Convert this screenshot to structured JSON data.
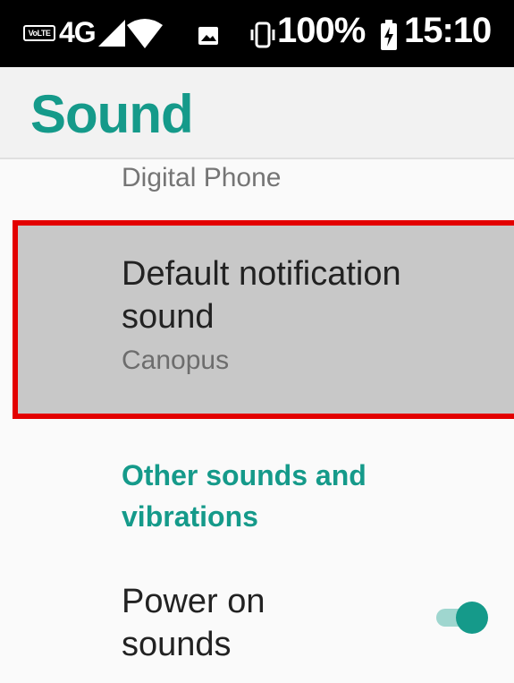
{
  "status_bar": {
    "volte": "VoLTE",
    "network": "4G",
    "battery": "100%",
    "time": "15:10",
    "icons": [
      "signal-icon",
      "wifi-icon",
      "image-notification-icon",
      "vibrate-icon",
      "battery-icon"
    ]
  },
  "header": {
    "title": "Sound"
  },
  "list": {
    "ringtone_value": "Digital Phone",
    "default_notification": {
      "title": "Default notification sound",
      "value": "Canopus"
    },
    "section_header": "Other sounds and vibrations",
    "power_on": {
      "label": "Power on sounds",
      "enabled": true
    }
  },
  "colors": {
    "accent": "#159a8a",
    "highlight_border": "#e30000",
    "status_bar": "#000000"
  }
}
